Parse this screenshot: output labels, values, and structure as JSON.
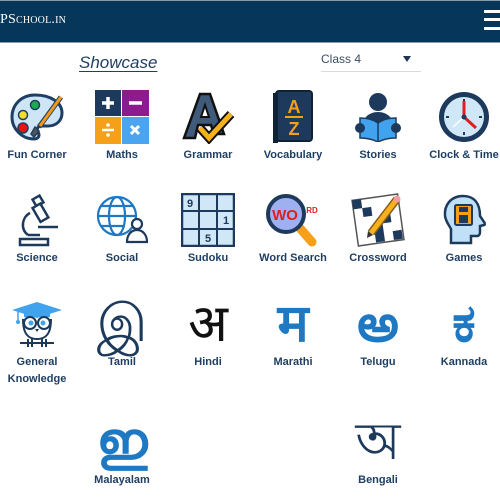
{
  "header": {
    "logo_text": "PSchool.in",
    "menu_icon": "hamburger-icon",
    "background": "#063659"
  },
  "showcase": {
    "title": "Showcase"
  },
  "class_select": {
    "selected": "Class 4"
  },
  "tiles": [
    {
      "label": "Fun Corner",
      "icon": "palette-icon"
    },
    {
      "label": "Maths",
      "icon": "math-operators-icon"
    },
    {
      "label": "Grammar",
      "icon": "letter-a-check-icon"
    },
    {
      "label": "Vocabulary",
      "icon": "dictionary-book-icon"
    },
    {
      "label": "Stories",
      "icon": "reading-person-icon"
    },
    {
      "label": "Clock & Time",
      "icon": "clock-icon"
    },
    {
      "label": "Science",
      "icon": "microscope-icon"
    },
    {
      "label": "Social",
      "icon": "globe-person-icon"
    },
    {
      "label": "Sudoku",
      "icon": "sudoku-grid-icon",
      "digits": [
        "9",
        "1",
        "5"
      ]
    },
    {
      "label": "Word Search",
      "icon": "magnifier-word-icon",
      "text_big": "WO",
      "text_small": "RD"
    },
    {
      "label": "Crossword",
      "icon": "crossword-pencil-icon"
    },
    {
      "label": "Games",
      "icon": "head-game-icon"
    },
    {
      "label": "General",
      "label2": "Knowledge",
      "icon": "owl-graduate-icon"
    },
    {
      "label": "Tamil",
      "icon": "tamil-letter-icon",
      "glyph": "இ"
    },
    {
      "label": "Hindi",
      "icon": "hindi-letter-icon",
      "glyph": "अ"
    },
    {
      "label": "Marathi",
      "icon": "marathi-letter-icon",
      "glyph": "म"
    },
    {
      "label": "Telugu",
      "icon": "telugu-letter-icon",
      "glyph": "అ"
    },
    {
      "label": "Kannada",
      "icon": "kannada-letter-icon",
      "glyph": "ಕ"
    },
    {
      "label": "Malayalam",
      "icon": "malayalam-letter-icon",
      "glyph": "ഇ"
    },
    {
      "label": "Bengali",
      "icon": "bengali-letter-icon",
      "glyph": "অ"
    }
  ]
}
